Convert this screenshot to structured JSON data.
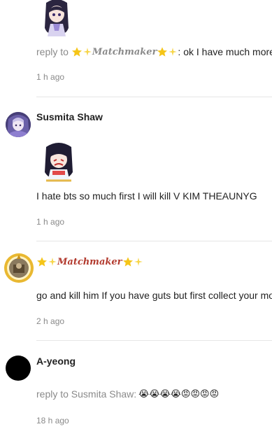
{
  "comments": [
    {
      "reply_prefix": "reply to",
      "reply_to_name": "Matchmaker",
      "text": ": ok I have much more m",
      "time": "1 h ago"
    },
    {
      "username": "Susmita Shaw",
      "text": "I hate bts so much first I will kill V KIM THEAUNYG",
      "time": "1 h ago"
    },
    {
      "username": "Matchmaker",
      "text": "go and kill him If you have guts but first collect your mo",
      "time": "2 h ago"
    },
    {
      "username": "A-yeong",
      "reply_prefix": "reply to Susmita Shaw:",
      "reply_emojis": "😭😭😭😭😡😡😡😡",
      "time": "18 h ago"
    }
  ],
  "icons": {
    "star": "star-icon",
    "sparkle": "sparkle-icon"
  },
  "colors": {
    "meta_gray": "#8a8a8a",
    "divider": "#e6e6e6",
    "star_gold": "#f5c518",
    "matchmaker_red": "#b23a2e"
  }
}
